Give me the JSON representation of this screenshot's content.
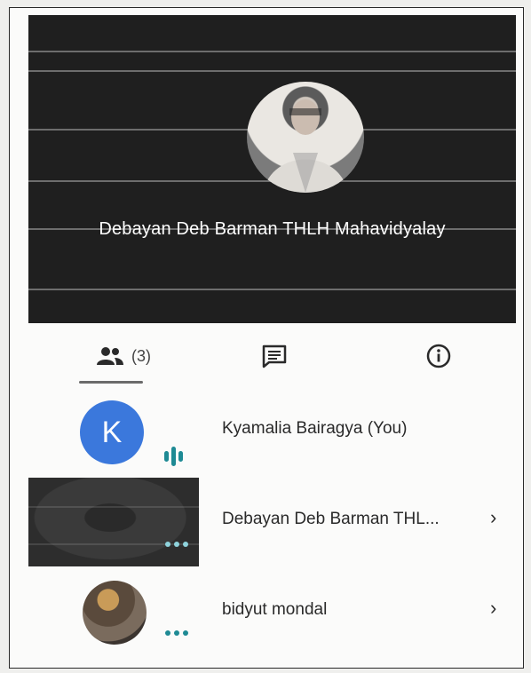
{
  "tile": {
    "name": "Debayan Deb Barman THLH Mahavidyalay"
  },
  "tabs": {
    "people_count": "(3)"
  },
  "participants": [
    {
      "name": "Kyamalia Bairagya (You)",
      "initial": "K",
      "avatar_color": "#3b78dc"
    },
    {
      "name": "Debayan Deb Barman THL..."
    },
    {
      "name": "bidyut mondal"
    }
  ],
  "icons": {
    "people": "people-icon",
    "chat": "chat-icon",
    "info": "info-icon",
    "speaking": "speaking-indicator-icon",
    "more": "more-dots-icon",
    "chevron": "chevron-right-icon"
  },
  "colors": {
    "accent": "#1e8a94",
    "avatar_k": "#3b78dc"
  }
}
